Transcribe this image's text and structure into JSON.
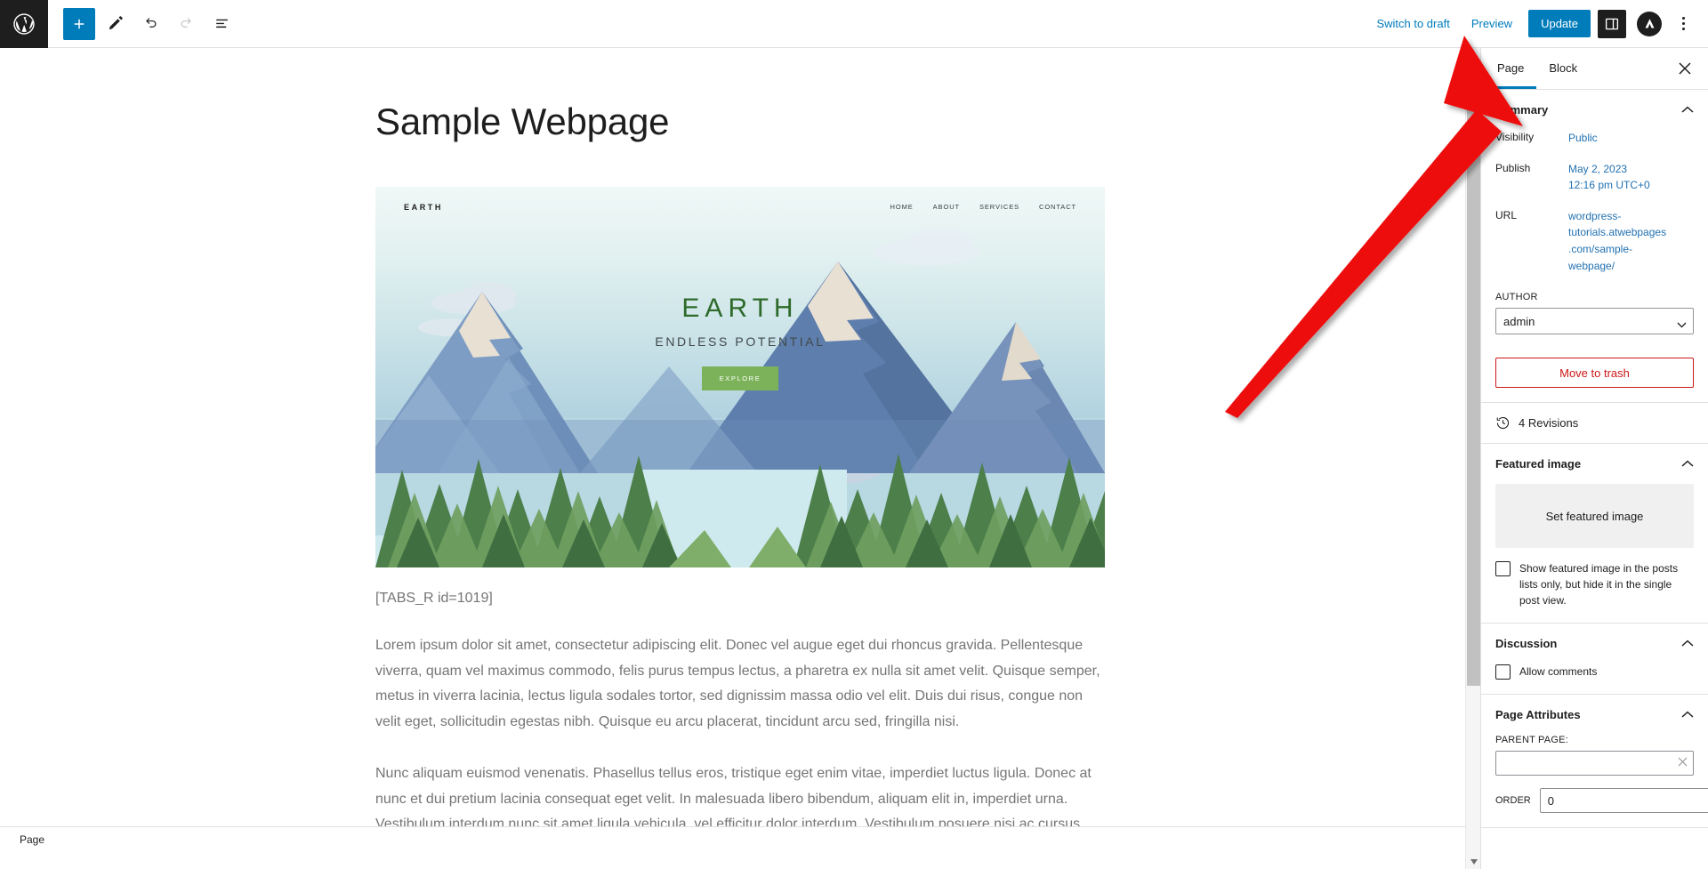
{
  "topbar": {
    "logo_icon": "wordpress-logo-icon",
    "tools": [
      {
        "name": "add-block-button",
        "icon": "plus-icon",
        "label": "Add block"
      },
      {
        "name": "edit-tool-button",
        "icon": "pencil-icon",
        "label": "Tools"
      },
      {
        "name": "undo-button",
        "icon": "undo-arrow-icon",
        "label": "Undo"
      },
      {
        "name": "redo-button",
        "icon": "redo-arrow-icon",
        "label": "Redo"
      },
      {
        "name": "list-view-button",
        "icon": "list-view-icon",
        "label": "Document overview"
      }
    ],
    "switch_to_draft": "Switch to draft",
    "preview": "Preview",
    "update": "Update",
    "settings_icon": "sidebar-panel-icon",
    "plugin_icon": "plugin-avatar-icon",
    "options_icon": "kebab-menu-icon"
  },
  "content": {
    "page_title": "Sample Webpage",
    "shortcode": "[TABS_R id=1019]",
    "paragraph_1": "Lorem ipsum dolor sit amet, consectetur adipiscing elit. Donec vel augue eget dui rhoncus gravida. Pellentesque viverra, quam vel maximus commodo, felis purus tempus lectus, a pharetra ex nulla sit amet velit. Quisque semper, metus in viverra lacinia, lectus ligula sodales tortor, sed dignissim massa odio vel elit. Duis dui risus, congue non velit eget, sollicitudin egestas nibh. Quisque eu arcu placerat, tincidunt arcu sed, fringilla nisi.",
    "paragraph_2": "Nunc aliquam euismod venenatis. Phasellus tellus eros, tristique eget enim vitae, imperdiet luctus ligula. Donec at nunc et dui pretium lacinia consequat eget velit. In malesuada libero bibendum, aliquam elit in, imperdiet urna. Vestibulum interdum nunc sit amet ligula vehicula, vel efficitur dolor interdum. Vestibulum posuere nisi ac cursus suscipit. Donec eget sodales sem. Nunc quis viverra eros. Praesent lacinia finibus ex, et faucibus purus.",
    "hero": {
      "brand": "EARTH",
      "menu": [
        "HOME",
        "ABOUT",
        "SERVICES",
        "CONTACT"
      ],
      "heading": "EARTH",
      "subheading": "ENDLESS POTENTIAL",
      "cta": "EXPLORE"
    }
  },
  "statusbar": {
    "block_type": "Page"
  },
  "sidebar": {
    "tabs": [
      {
        "label": "Page",
        "active": true
      },
      {
        "label": "Block",
        "active": false
      }
    ],
    "close_icon": "close-icon",
    "summary": {
      "title": "Summary",
      "visibility_label": "Visibility",
      "visibility_value": "Public",
      "publish_label": "Publish",
      "publish_value_date": "May 2, 2023",
      "publish_value_time": "12:16 pm UTC+0",
      "url_label": "URL",
      "url_value": "wordpress-tutorials.atwebpages.com/sample-webpage/",
      "author_label": "AUTHOR",
      "author_value": "admin",
      "trash_label": "Move to trash"
    },
    "revisions": {
      "icon": "clock-history-icon",
      "label": "4 Revisions"
    },
    "featured_image": {
      "title": "Featured image",
      "set_label": "Set featured image",
      "checkbox_label": "Show featured image in the posts lists only, but hide it in the single post view.",
      "checkbox_checked": false
    },
    "discussion": {
      "title": "Discussion",
      "allow_comments_label": "Allow comments",
      "allow_comments_checked": false
    },
    "page_attributes": {
      "title": "Page Attributes",
      "parent_page_label": "PARENT PAGE:",
      "parent_page_value": "",
      "parent_page_clear_icon": "clear-x-icon",
      "order_label": "ORDER",
      "order_value": "0"
    }
  },
  "annotation": {
    "arrow_color": "#ee1111",
    "points_at": "page-tab"
  },
  "colors": {
    "accent": "#007cba",
    "link": "#2271b1",
    "danger": "#cc1818",
    "dark": "#1e1e1e",
    "muted": "#757575"
  }
}
